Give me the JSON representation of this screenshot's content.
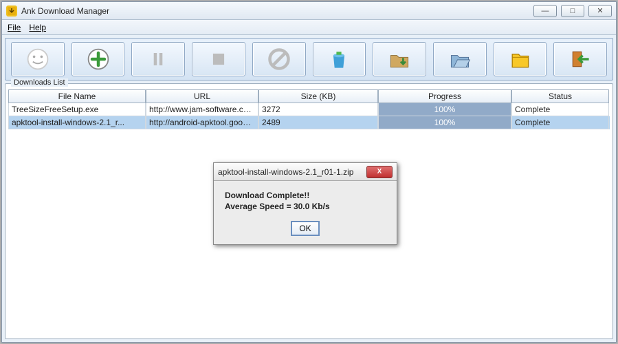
{
  "window": {
    "title": "Ank Download Manager"
  },
  "menu": {
    "file": "File",
    "help": "Help"
  },
  "group": {
    "label": "Downloads List"
  },
  "columns": {
    "name": "File Name",
    "url": "URL",
    "size": "Size (KB)",
    "progress": "Progress",
    "status": "Status"
  },
  "rows": [
    {
      "name": "TreeSizeFreeSetup.exe",
      "url": "http://www.jam-software.com/...",
      "size": "3272",
      "progress": "100%",
      "status": "Complete"
    },
    {
      "name": "apktool-install-windows-2.1_r...",
      "url": "http://android-apktool.googlec...",
      "size": "2489",
      "progress": "100%",
      "status": "Complete"
    }
  ],
  "dialog": {
    "title": "apktool-install-windows-2.1_r01-1.zip",
    "line1": "Download Complete!!",
    "line2": "Average Speed = 30.0 Kb/s",
    "ok": "OK",
    "close": "X"
  },
  "winbtns": {
    "min": "—",
    "max": "□",
    "close": "✕"
  }
}
